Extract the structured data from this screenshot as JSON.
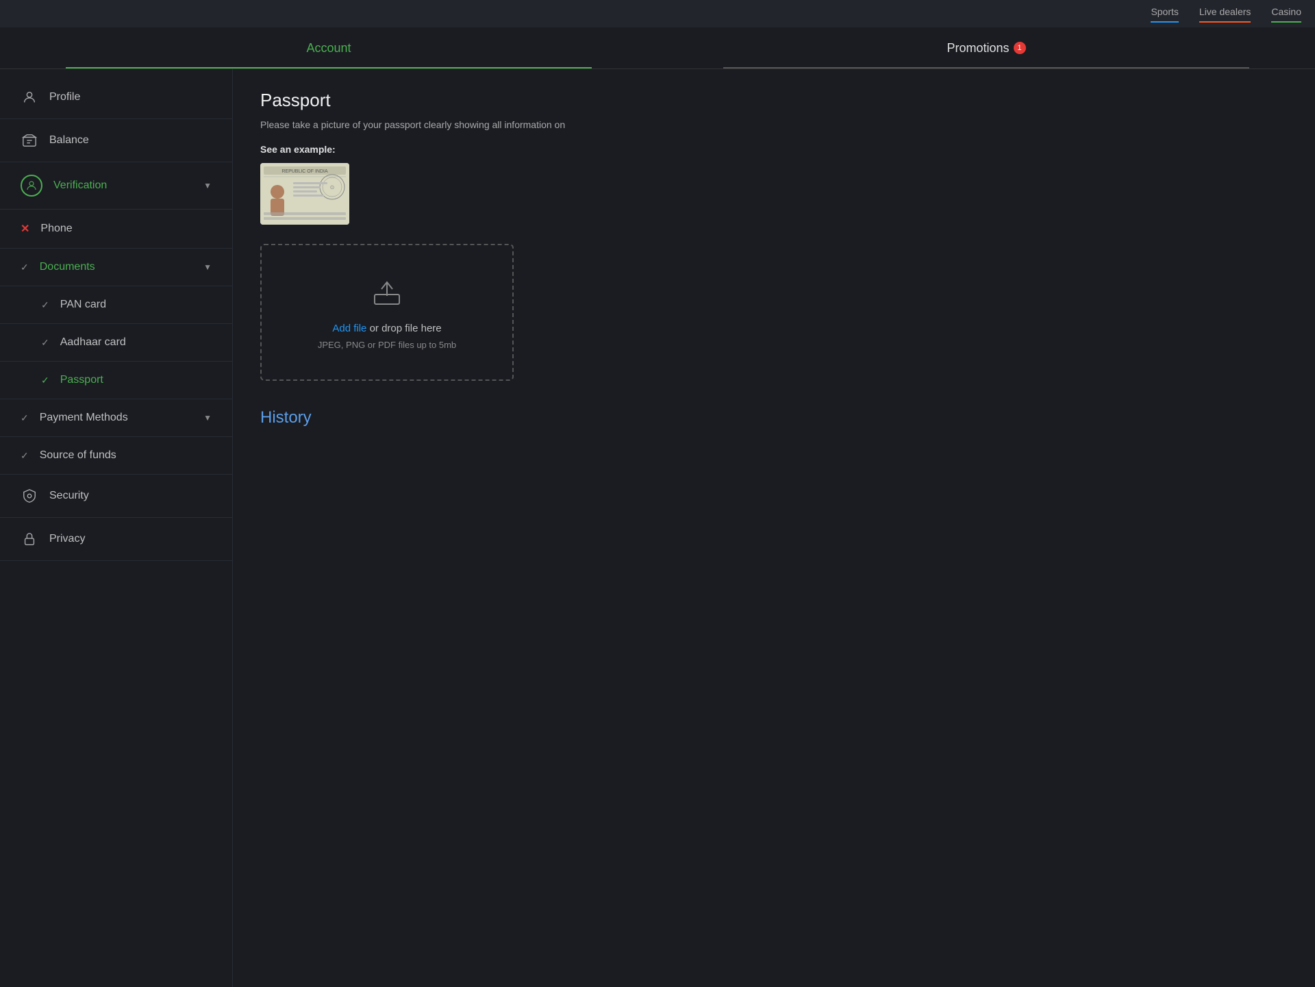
{
  "top_nav": {
    "items": [
      {
        "id": "sports",
        "label": "Sports",
        "class": "sports"
      },
      {
        "id": "live",
        "label": "Live dealers",
        "class": "live"
      },
      {
        "id": "casino",
        "label": "Casino",
        "class": "casino"
      }
    ]
  },
  "second_nav": {
    "tabs": [
      {
        "id": "account",
        "label": "Account",
        "active": true
      },
      {
        "id": "promotions",
        "label": "Promotions",
        "active": false,
        "badge": "1"
      }
    ]
  },
  "sidebar": {
    "items": [
      {
        "id": "profile",
        "label": "Profile",
        "icon": "profile",
        "status": "none"
      },
      {
        "id": "balance",
        "label": "Balance",
        "icon": "balance",
        "status": "none"
      },
      {
        "id": "verification",
        "label": "Verification",
        "icon": "verification",
        "status": "active",
        "hasChevron": true
      },
      {
        "id": "phone",
        "label": "Phone",
        "icon": "phone",
        "status": "error"
      },
      {
        "id": "documents",
        "label": "Documents",
        "icon": "documents",
        "status": "check",
        "hasChevron": true
      },
      {
        "id": "pan-card",
        "label": "PAN card",
        "icon": "none",
        "status": "check",
        "sub": true
      },
      {
        "id": "aadhaar-card",
        "label": "Aadhaar card",
        "icon": "none",
        "status": "check",
        "sub": true
      },
      {
        "id": "passport",
        "label": "Passport",
        "icon": "none",
        "status": "check",
        "sub": true,
        "active": true
      },
      {
        "id": "payment-methods",
        "label": "Payment Methods",
        "icon": "none",
        "status": "check",
        "hasChevron": true
      },
      {
        "id": "source-of-funds",
        "label": "Source of funds",
        "icon": "none",
        "status": "check"
      },
      {
        "id": "security",
        "label": "Security",
        "icon": "security",
        "status": "none"
      },
      {
        "id": "privacy",
        "label": "Privacy",
        "icon": "privacy",
        "status": "none"
      }
    ]
  },
  "main": {
    "title": "Passport",
    "description": "Please take a picture of your passport clearly showing all information on",
    "see_example_label": "See an example:",
    "upload": {
      "add_file_label": "Add file",
      "or_drop_label": " or drop file here",
      "hint": "JPEG, PNG or PDF files up to 5mb"
    },
    "history_title": "History"
  }
}
